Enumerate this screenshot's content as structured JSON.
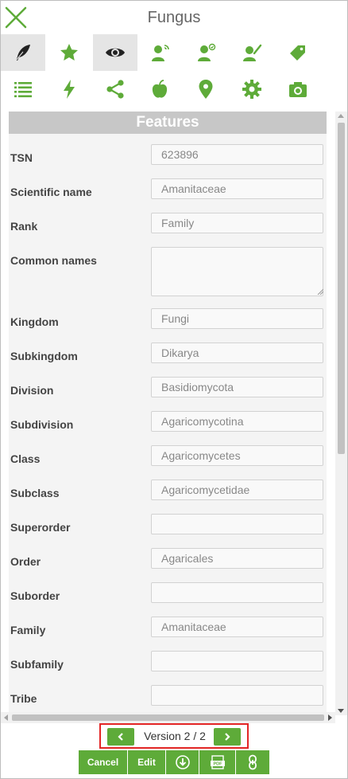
{
  "window": {
    "title": "Fungus"
  },
  "colors": {
    "accent": "#5eab39",
    "highlight_border": "#e32626",
    "header_bg": "#c7c7c7"
  },
  "tabs_row1": [
    {
      "icon": "feather-icon",
      "active": true
    },
    {
      "icon": "star-icon"
    },
    {
      "icon": "eye-icon",
      "active": true
    },
    {
      "icon": "user-wifi-icon"
    },
    {
      "icon": "user-check-icon"
    },
    {
      "icon": "user-edit-icon"
    },
    {
      "icon": "tag-icon"
    }
  ],
  "tabs_row2": [
    {
      "icon": "list-icon"
    },
    {
      "icon": "lightning-icon"
    },
    {
      "icon": "share-icon"
    },
    {
      "icon": "apple-icon"
    },
    {
      "icon": "map-pin-icon"
    },
    {
      "icon": "gear-icon"
    },
    {
      "icon": "camera-icon"
    }
  ],
  "features": {
    "header": "Features",
    "rows": [
      {
        "label": "TSN",
        "value": "623896"
      },
      {
        "label": "Scientific name",
        "value": "Amanitaceae"
      },
      {
        "label": "Rank",
        "value": "Family"
      },
      {
        "label": "Common names",
        "value": "",
        "multiline": true
      },
      {
        "label": "Kingdom",
        "value": "Fungi"
      },
      {
        "label": "Subkingdom",
        "value": "Dikarya"
      },
      {
        "label": "Division",
        "value": "Basidiomycota"
      },
      {
        "label": "Subdivision",
        "value": "Agaricomycotina"
      },
      {
        "label": "Class",
        "value": "Agaricomycetes"
      },
      {
        "label": "Subclass",
        "value": "Agaricomycetidae"
      },
      {
        "label": "Superorder",
        "value": ""
      },
      {
        "label": "Order",
        "value": "Agaricales"
      },
      {
        "label": "Suborder",
        "value": ""
      },
      {
        "label": "Family",
        "value": "Amanitaceae"
      },
      {
        "label": "Subfamily",
        "value": ""
      },
      {
        "label": "Tribe",
        "value": ""
      }
    ]
  },
  "version": {
    "text": "Version 2 / 2"
  },
  "actions": {
    "cancel": "Cancel",
    "edit": "Edit"
  }
}
